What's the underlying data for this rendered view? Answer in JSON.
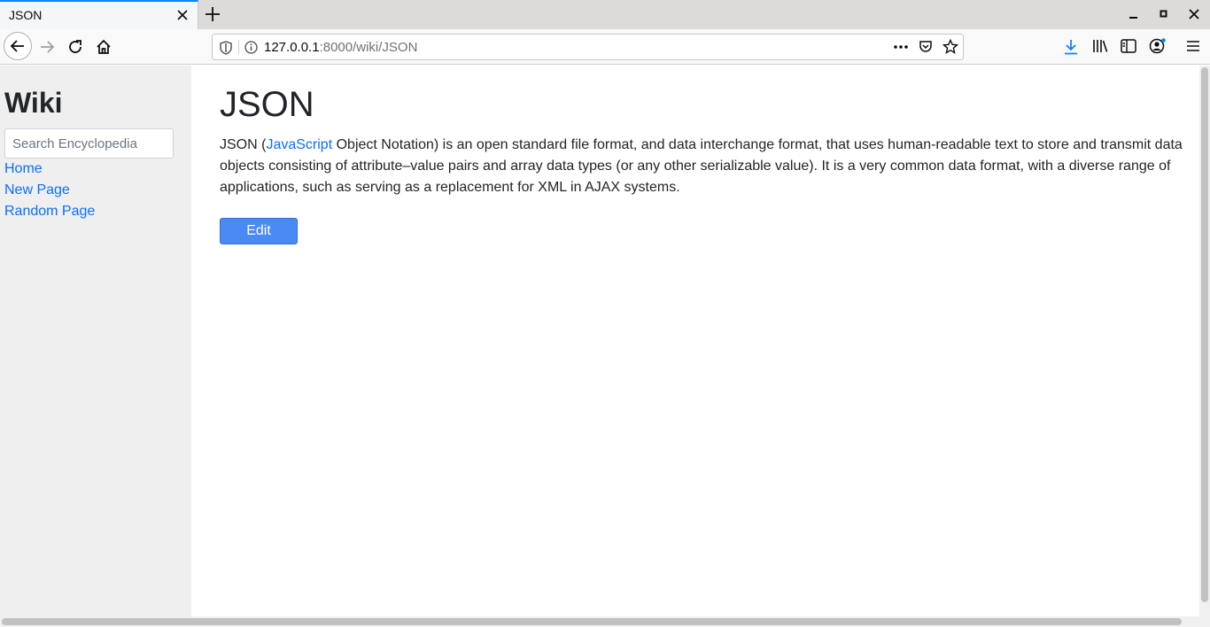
{
  "browser": {
    "tab_title": "JSON",
    "url_host": "127.0.0.1",
    "url_rest": ":8000/wiki/JSON"
  },
  "sidebar": {
    "title": "Wiki",
    "search_placeholder": "Search Encyclopedia",
    "links": [
      "Home",
      "New Page",
      "Random Page"
    ]
  },
  "article": {
    "title": "JSON",
    "para_before_link": "JSON (",
    "link_text": "JavaScript",
    "para_after_link": " Object Notation) is an open standard file format, and data interchange format, that uses human-readable text to store and transmit data objects consisting of attribute–value pairs and array data types (or any other serializable value). It is a very common data format, with a diverse range of applications, such as serving as a replacement for XML in AJAX systems.",
    "edit_label": "Edit"
  },
  "colors": {
    "link": "#0d6efd",
    "button": "#4a8af4",
    "sidebar_bg": "#efefef",
    "accent": "#0a84ff"
  }
}
